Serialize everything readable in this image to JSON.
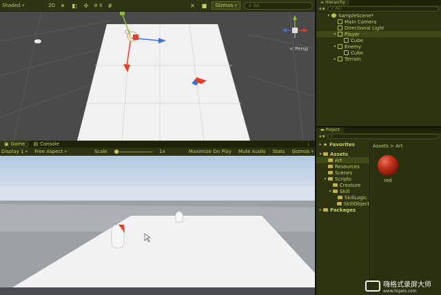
{
  "scene": {
    "toolbar": {
      "shading_mode": "Shaded",
      "mode_2d": "2D",
      "fx_count": "0",
      "gizmos_label": "Gizmos",
      "search_placeholder": "All"
    },
    "view_gizmo_label": "< Persp"
  },
  "game": {
    "tabs": [
      {
        "label": "Game"
      },
      {
        "label": "Console"
      }
    ],
    "toolbar": {
      "display": "Display 1",
      "aspect": "Free Aspect",
      "scale_label": "Scale",
      "scale_value": "1x",
      "scale_fraction": 0.0,
      "maximize_on_play": "Maximize On Play",
      "mute_audio": "Mute Audio",
      "stats": "Stats",
      "gizmos": "Gizmos"
    }
  },
  "hierarchy": {
    "tab_label": "Hierarchy",
    "search_placeholder": "All",
    "items": [
      {
        "label": "SampleScene*",
        "depth": 0,
        "icon": "scene-icon",
        "expanded": true,
        "selected": false
      },
      {
        "label": "Main Camera",
        "depth": 1,
        "icon": "cube-icon",
        "expanded": null,
        "selected": false
      },
      {
        "label": "Directional Light",
        "depth": 1,
        "icon": "cube-icon",
        "expanded": null,
        "selected": false
      },
      {
        "label": "Player",
        "depth": 1,
        "icon": "cube-icon",
        "expanded": true,
        "selected": true
      },
      {
        "label": "Cube",
        "depth": 2,
        "icon": "cube-icon",
        "expanded": null,
        "selected": false
      },
      {
        "label": "Enemy",
        "depth": 1,
        "icon": "cube-icon",
        "expanded": true,
        "selected": false
      },
      {
        "label": "Cube",
        "depth": 2,
        "icon": "cube-icon",
        "expanded": null,
        "selected": false
      },
      {
        "label": "Terrain",
        "depth": 1,
        "icon": "cube-icon",
        "expanded": false,
        "selected": false
      }
    ]
  },
  "project": {
    "tab_label": "Project",
    "favorites_label": "Favorites",
    "tree": [
      {
        "label": "Assets",
        "depth": 0,
        "expanded": true,
        "bold": true,
        "selected": false
      },
      {
        "label": "Art",
        "depth": 1,
        "expanded": null,
        "bold": false,
        "selected": true
      },
      {
        "label": "Resources",
        "depth": 1,
        "expanded": null,
        "bold": false,
        "selected": false
      },
      {
        "label": "Scenes",
        "depth": 1,
        "expanded": null,
        "bold": false,
        "selected": false
      },
      {
        "label": "Scripts",
        "depth": 1,
        "expanded": true,
        "bold": false,
        "selected": false
      },
      {
        "label": "Creature",
        "depth": 2,
        "expanded": null,
        "bold": false,
        "selected": false
      },
      {
        "label": "Skill",
        "depth": 2,
        "expanded": true,
        "bold": false,
        "selected": false
      },
      {
        "label": "SkillLogic",
        "depth": 3,
        "expanded": null,
        "bold": false,
        "selected": false
      },
      {
        "label": "SkillObject",
        "depth": 3,
        "expanded": null,
        "bold": false,
        "selected": false
      },
      {
        "label": "Packages",
        "depth": 0,
        "expanded": false,
        "bold": true,
        "selected": false
      }
    ],
    "breadcrumb": {
      "root": "Assets",
      "separator": ">",
      "current": "Art"
    },
    "assets": [
      {
        "name": "red"
      }
    ]
  },
  "watermark": {
    "title": "嗨格式录屏大师",
    "url": "www.higeis.com"
  },
  "colors": {
    "panel_bg": "#2e3412",
    "accent_text": "#c8d06a",
    "scene_bg": "#4a4a4a",
    "sky_top": "#b6cce4",
    "ground_plane": "#f0f0f0",
    "axis_x": "#e0432a",
    "axis_y": "#8fbf3a",
    "axis_z": "#3d74c9"
  }
}
